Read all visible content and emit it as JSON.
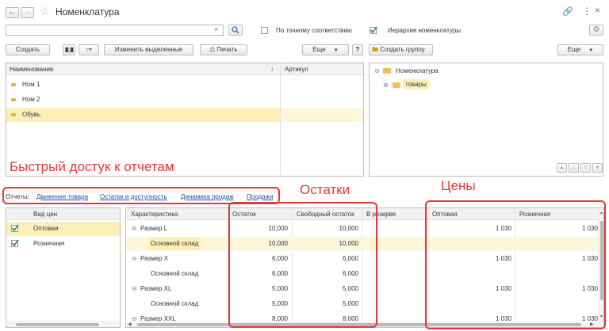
{
  "window": {
    "title": "Номенклатура"
  },
  "search": {
    "value": "",
    "clear_glyph": "×",
    "exact_match_label": "По точному соответствию",
    "hierarchy_label": "Иерархия номенклатуры",
    "hierarchy_checked": true,
    "exact_checked": false
  },
  "toolbar": {
    "create": "Создать",
    "change_selected": "Изменить выделенные",
    "print": "Печать",
    "more": "Еще",
    "help": "?",
    "create_group": "Создать группу",
    "more_right": "Еще"
  },
  "list": {
    "headers": {
      "name": "Наименование",
      "sort": "↓",
      "article": "Артикул"
    },
    "rows": [
      {
        "name": "Ном 1"
      },
      {
        "name": "Ном 2"
      },
      {
        "name": "Обувь"
      }
    ]
  },
  "tree": {
    "root": "Номенклатура",
    "child": "товары"
  },
  "annotations": {
    "reports": "Быстрый достук к отчетам",
    "stock": "Остатки",
    "prices": "Цены"
  },
  "reports": {
    "label": "Отчеты:",
    "links": [
      "Движение товара",
      "Остатки и доступность",
      "Динамика продаж",
      "Продажи"
    ]
  },
  "price_types": {
    "header": "Вид цен",
    "rows": [
      {
        "name": "Оптовая",
        "checked": true
      },
      {
        "name": "Розничная",
        "checked": true
      }
    ]
  },
  "stock": {
    "headers": {
      "characteristic": "Характеристика",
      "rest": "Остаток",
      "free": "Свободный остаток",
      "reserve": "В резерве",
      "wholesale": "Оптовая",
      "retail": "Розничная"
    },
    "rows": [
      {
        "char": "Размер L",
        "rest": "10,000",
        "free": "10,000",
        "wholesale": "1 030",
        "retail": "1 030"
      },
      {
        "char": "Основной склад",
        "rest": "10,000",
        "free": "10,000",
        "wholesale": "",
        "retail": ""
      },
      {
        "char": "Размер X",
        "rest": "6,000",
        "free": "6,000",
        "wholesale": "1 030",
        "retail": "1 030"
      },
      {
        "char": "Основной склад",
        "rest": "6,000",
        "free": "6,000",
        "wholesale": "",
        "retail": ""
      },
      {
        "char": "Размер XL",
        "rest": "5,000",
        "free": "5,000",
        "wholesale": "1 030",
        "retail": "1 030"
      },
      {
        "char": "Основной склад",
        "rest": "5,000",
        "free": "5,000",
        "wholesale": "",
        "retail": ""
      },
      {
        "char": "Размер XXL",
        "rest": "8,000",
        "free": "8,000",
        "wholesale": "1 030",
        "retail": "1 030"
      }
    ]
  },
  "colors": {
    "selection": "#fdefb8",
    "annotation": "#e53935",
    "link": "#1a4fa8",
    "folder": "#f2c14e"
  }
}
